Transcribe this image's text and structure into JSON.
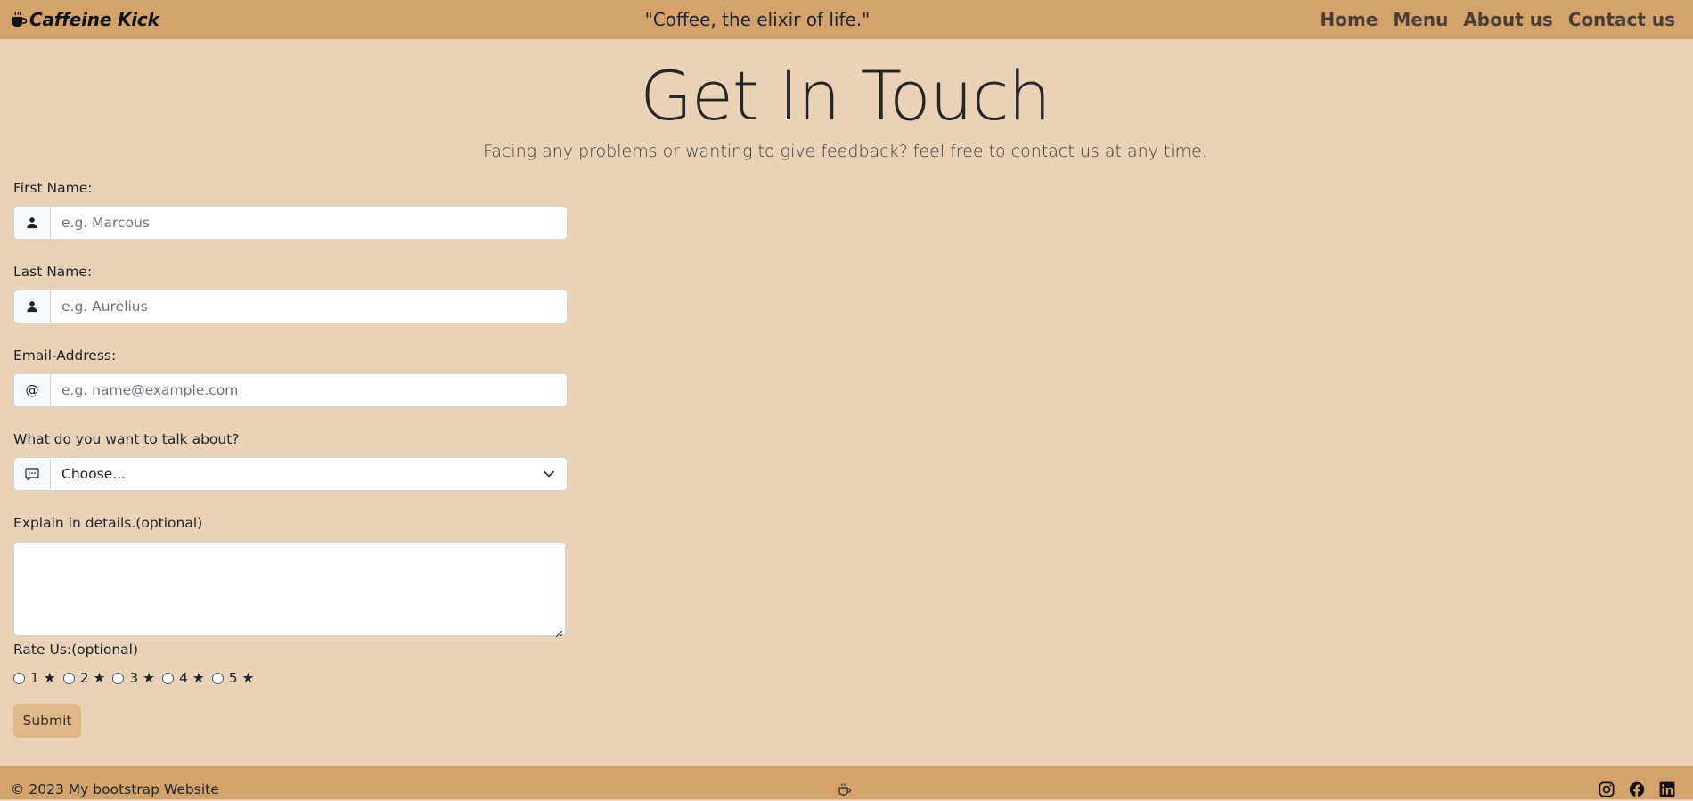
{
  "navbar": {
    "brand": "Caffeine Kick",
    "brand_icon": "coffee-cup-icon",
    "quote": "\"Coffee, the elixir of life.\"",
    "links": [
      {
        "label": "Home"
      },
      {
        "label": "Menu"
      },
      {
        "label": "About us"
      },
      {
        "label": "Contact us"
      }
    ]
  },
  "header": {
    "title": "Get In Touch",
    "subtitle": "Facing any problems or wanting to give feedback? feel free to contact us at any time."
  },
  "form": {
    "first_name": {
      "label": "First Name:",
      "placeholder": "e.g. Marcous",
      "icon": "person-icon"
    },
    "last_name": {
      "label": "Last Name:",
      "placeholder": "e.g. Aurelius",
      "icon": "person-icon"
    },
    "email": {
      "label": "Email-Address:",
      "placeholder": "e.g. name@example.com",
      "icon_text": "@"
    },
    "topic": {
      "label": "What do you want to talk about?",
      "selected": "Choose...",
      "icon": "chat-dots-icon"
    },
    "details": {
      "label": "Explain in details.(optional)"
    },
    "rating": {
      "label": "Rate Us:(optional)",
      "options": [
        "1 ★",
        "2 ★",
        "3 ★",
        "4 ★",
        "5 ★"
      ]
    },
    "submit_label": "Submit"
  },
  "footer": {
    "copyright": "© 2023 My bootstrap Website",
    "icons": [
      "coffee-cup-icon",
      "instagram-icon",
      "facebook-icon",
      "linkedin-icon"
    ]
  },
  "colors": {
    "navbar_bg": "#d4a36b",
    "page_bg": "#ead2b8",
    "submit_bg": "#dfb98a"
  }
}
